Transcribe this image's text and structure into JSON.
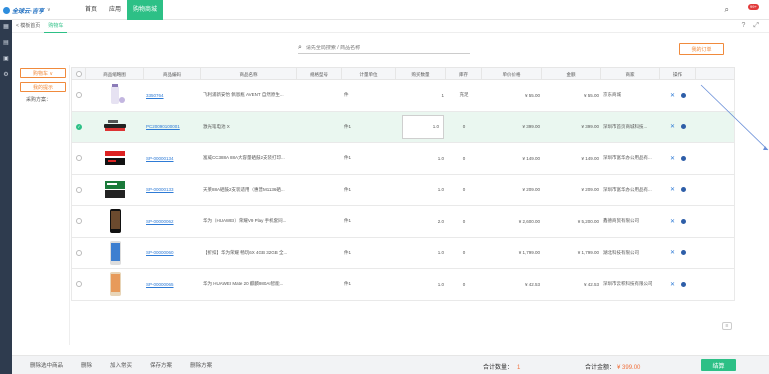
{
  "brand": {
    "name": "全球云·吉亨"
  },
  "nav": {
    "items": [
      "首页",
      "应用",
      "购物商城"
    ],
    "active_index": 2
  },
  "topbar": {
    "notifications": "99+"
  },
  "subtabs": [
    "< 模板首页",
    "购物车"
  ],
  "search": {
    "placeholder": "请先全局搜索 / 商品名称"
  },
  "my_orders_label": "我的订单",
  "left_panel": {
    "cart_label": "购物车 ∨",
    "reminder_label": "我的提示",
    "plan_label": "采购方案："
  },
  "table": {
    "headers": [
      "",
      "商品缩略图",
      "商品编码",
      "商品名称",
      "规格型号",
      "计量单位",
      "购买数量",
      "库存",
      "单价价格",
      "金额",
      "商家",
      "操作"
    ],
    "rows": [
      {
        "code": "3350764",
        "name": "飞利浦新安怡 佩恩瓶 AVENT 自然原生...",
        "spec": "",
        "unit": "件",
        "qty": "1",
        "stock": "充足",
        "price": "¥ 55.00",
        "amount": "¥ 55.00",
        "vendor": "京东商城",
        "selected": false
      },
      {
        "code": "PC20090100001",
        "name": "激光笔电池 X",
        "spec": "",
        "unit": "件1",
        "qty": "1.0",
        "stock": "0",
        "price": "¥ 399.00",
        "amount": "¥ 399.00",
        "vendor": "深圳市首页商城科技...",
        "selected": true
      },
      {
        "code": "SP-00000134",
        "name": "富威CC388A 88A大容量硒鼓2支装打印...",
        "spec": "",
        "unit": "件1",
        "qty": "1.0",
        "stock": "0",
        "price": "¥ 149.00",
        "amount": "¥ 149.00",
        "vendor": "深圳市富华办公用品有...",
        "selected": false
      },
      {
        "code": "SP-00000133",
        "name": "天莱88A硒鼓2支装适用（惠普M1136硒...",
        "spec": "",
        "unit": "件1",
        "qty": "1.0",
        "stock": "0",
        "price": "¥ 209.00",
        "amount": "¥ 209.00",
        "vendor": "深圳市富华办公用品有...",
        "selected": false
      },
      {
        "code": "SP-00000062",
        "name": "华为（HUAWEI）荣耀V9 Play 手机套同...",
        "spec": "",
        "unit": "件1",
        "qty": "2.0",
        "stock": "0",
        "price": "¥ 2,600.00",
        "amount": "¥ 5,200.00",
        "vendor": "鑫德商贸有限公司",
        "selected": false
      },
      {
        "code": "SP-00000060",
        "name": "【折扣】华为荣耀 畅玩6X 4GB 32GB 全...",
        "spec": "",
        "unit": "件1",
        "qty": "1.0",
        "stock": "0",
        "price": "¥ 1,799.00",
        "amount": "¥ 1,799.00",
        "vendor": "湖北科技有限公司",
        "selected": false
      },
      {
        "code": "SP-00000065",
        "name": "华为 HUAWEI Mate 20 麒麟980AI智能...",
        "spec": "",
        "unit": "件1",
        "qty": "1.0",
        "stock": "0",
        "price": "¥ 42.53",
        "amount": "¥ 42.53",
        "vendor": "深圳市云积科技有限公司",
        "selected": false
      }
    ]
  },
  "bottom": {
    "links": [
      "删除选中商品",
      "删除",
      "加入常买",
      "保存方案",
      "删除方案"
    ],
    "sum_qty_label": "合计数量：",
    "sum_qty": "1",
    "sum_amount_label": "合计金额：",
    "sum_amount": "¥ 399.00",
    "settle_label": "结算"
  },
  "colors": {
    "accent": "#2dc086",
    "orange": "#f08a3c",
    "link": "#2e7bd6",
    "rail": "#2e3b4e"
  }
}
